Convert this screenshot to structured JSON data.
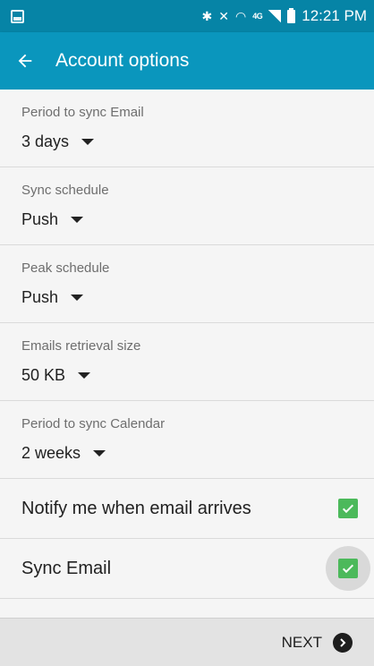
{
  "status_bar": {
    "left_icons": [
      "gallery-icon"
    ],
    "right_icons": [
      "bluetooth-icon",
      "mute-icon",
      "wifi-icon",
      "lte-icon",
      "signal-icon",
      "battery-icon"
    ],
    "network_label": "4G",
    "time": "12:21 PM",
    "background": "#0684a6"
  },
  "app_bar": {
    "title": "Account options",
    "back_icon": "back-arrow-icon",
    "background": "#0a96bd"
  },
  "settings": [
    {
      "label": "Period to sync Email",
      "value": "3 days"
    },
    {
      "label": "Sync schedule",
      "value": "Push"
    },
    {
      "label": "Peak schedule",
      "value": "Push"
    },
    {
      "label": "Emails retrieval size",
      "value": "50 KB"
    },
    {
      "label": "Period to sync Calendar",
      "value": "2 weeks"
    }
  ],
  "checkboxes": [
    {
      "label": "Notify me when email arrives",
      "checked": true
    },
    {
      "label": "Sync Email",
      "checked": true
    }
  ],
  "checkbox_color": "#4cb95b",
  "bottom_bar": {
    "next_label": "NEXT",
    "next_icon": "chevron-right-circle-icon"
  }
}
